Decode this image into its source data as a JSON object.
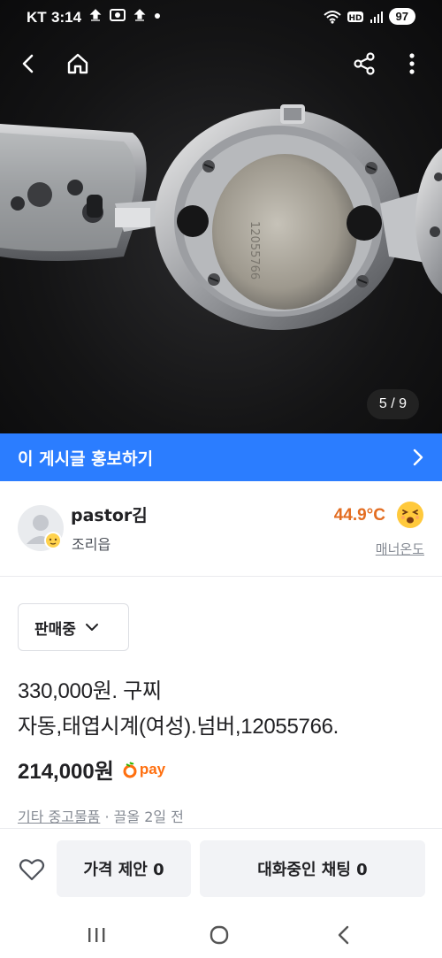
{
  "status_bar": {
    "carrier": "KT",
    "time": "3:14",
    "battery": "97"
  },
  "photo": {
    "counter": "5 / 9"
  },
  "promo": {
    "label": "이 게시글 홍보하기"
  },
  "seller": {
    "name": "pastor김",
    "location": "조리읍",
    "temperature": "44.9°C",
    "manner_label": "매너온도"
  },
  "listing": {
    "status": "판매중",
    "title_line1": "330,000원. 구찌",
    "title_line2": "자동,태엽시계(여성).넘버,12055766.",
    "price": "214,000원",
    "pay_label": "pay",
    "category": "기타 중고물품",
    "meta_separator": " · ",
    "posted": "끌올 2일 전"
  },
  "actions": {
    "offer_label": "가격 제안 0",
    "chat_label": "대화중인 채팅 0"
  },
  "colors": {
    "accent_blue": "#2b7dff",
    "orange": "#ff6f0f",
    "temp_orange": "#e36d21"
  }
}
